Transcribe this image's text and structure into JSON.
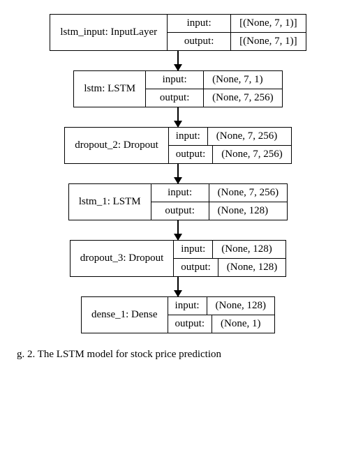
{
  "nodes": [
    {
      "name": "lstm_input: InputLayer",
      "input_label": "input:",
      "input_value": "[(None, 7, 1)]",
      "output_label": "output:",
      "output_value": "[(None, 7, 1)]"
    },
    {
      "name": "lstm: LSTM",
      "input_label": "input:",
      "input_value": "(None, 7, 1)",
      "output_label": "output:",
      "output_value": "(None, 7, 256)"
    },
    {
      "name": "dropout_2: Dropout",
      "input_label": "input:",
      "input_value": "(None, 7, 256)",
      "output_label": "output:",
      "output_value": "(None, 7, 256)"
    },
    {
      "name": "lstm_1: LSTM",
      "input_label": "input:",
      "input_value": "(None, 7, 256)",
      "output_label": "output:",
      "output_value": "(None, 128)"
    },
    {
      "name": "dropout_3: Dropout",
      "input_label": "input:",
      "input_value": "(None, 128)",
      "output_label": "output:",
      "output_value": "(None, 128)"
    },
    {
      "name": "dense_1: Dense",
      "input_label": "input:",
      "input_value": "(None, 128)",
      "output_label": "output:",
      "output_value": "(None, 1)"
    }
  ],
  "caption": "g. 2. The LSTM model for stock price prediction",
  "chart_data": {
    "type": "diagram",
    "description": "Keras model architecture graph (plot_model output) as a vertical flowchart with arrows between layers",
    "layers": [
      {
        "layer": "lstm_input",
        "class": "InputLayer",
        "input": "[(None, 7, 1)]",
        "output": "[(None, 7, 1)]"
      },
      {
        "layer": "lstm",
        "class": "LSTM",
        "input": "(None, 7, 1)",
        "output": "(None, 7, 256)"
      },
      {
        "layer": "dropout_2",
        "class": "Dropout",
        "input": "(None, 7, 256)",
        "output": "(None, 7, 256)"
      },
      {
        "layer": "lstm_1",
        "class": "LSTM",
        "input": "(None, 7, 256)",
        "output": "(None, 128)"
      },
      {
        "layer": "dropout_3",
        "class": "Dropout",
        "input": "(None, 128)",
        "output": "(None, 128)"
      },
      {
        "layer": "dense_1",
        "class": "Dense",
        "input": "(None, 128)",
        "output": "(None, 1)"
      }
    ]
  }
}
